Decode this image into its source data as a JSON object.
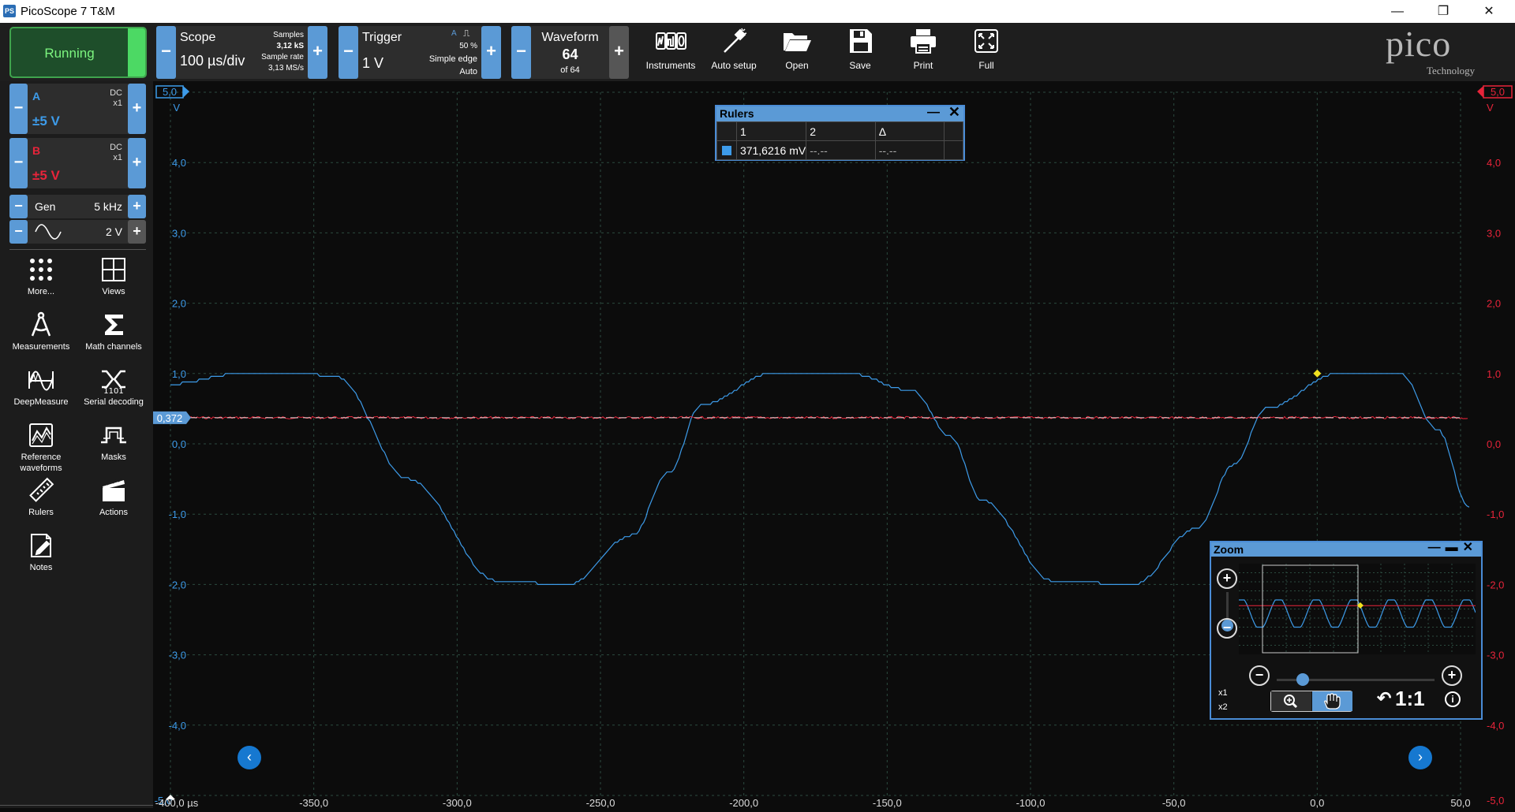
{
  "window": {
    "title": "PicoScope 7 T&M",
    "icon_text": "PS",
    "controls": [
      "minimize-icon",
      "restore-icon",
      "close-icon"
    ]
  },
  "toolbar": {
    "run_label": "Running",
    "scope": {
      "title": "Scope",
      "value": "100 µs/div",
      "samples_label": "Samples",
      "samples_value": "3,12 kS",
      "rate_label": "Sample rate",
      "rate_value": "3,13 MS/s"
    },
    "trigger": {
      "title": "Trigger",
      "value": "1 V",
      "channel": "A",
      "percent": "50 %",
      "mode": "Simple edge",
      "auto": "Auto"
    },
    "waveform": {
      "title": "Waveform",
      "value": "64",
      "of": "of 64"
    },
    "tools": [
      {
        "label": "Instruments",
        "icon": "instruments-icon"
      },
      {
        "label": "Auto setup",
        "icon": "auto-setup-icon"
      },
      {
        "label": "Open",
        "icon": "folder-open-icon"
      },
      {
        "label": "Save",
        "icon": "save-icon"
      },
      {
        "label": "Print",
        "icon": "print-icon"
      },
      {
        "label": "Full",
        "icon": "fullscreen-icon"
      }
    ],
    "logo_top": "pico",
    "logo_bottom": "Technology"
  },
  "sidebar": {
    "channel_a": {
      "name": "A",
      "coupling": "DC",
      "probe": "x1",
      "range": "±5 V",
      "color": "#3d9be9"
    },
    "channel_b": {
      "name": "B",
      "coupling": "DC",
      "probe": "x1",
      "range": "±5 V",
      "color": "#e8243a"
    },
    "gen": {
      "label": "Gen",
      "freq": "5 kHz",
      "ampl": "2 V",
      "wave_icon": "sine-wave-icon"
    },
    "tools": [
      {
        "label": "More...",
        "icon": "more-dots-icon"
      },
      {
        "label": "Views",
        "icon": "views-grid-icon"
      },
      {
        "label": "Measurements",
        "icon": "measurements-icon"
      },
      {
        "label": "Math channels",
        "icon": "sigma-icon"
      },
      {
        "label": "DeepMeasure",
        "icon": "deepmeasure-icon"
      },
      {
        "label": "Serial decoding",
        "icon": "serial-decoding-icon"
      },
      {
        "label": "Reference waveforms",
        "icon": "reference-waveforms-icon"
      },
      {
        "label": "Masks",
        "icon": "masks-icon"
      },
      {
        "label": "Rulers",
        "icon": "ruler-icon"
      },
      {
        "label": "Actions",
        "icon": "clapperboard-icon"
      },
      {
        "label": "Notes",
        "icon": "notes-icon"
      }
    ]
  },
  "plot": {
    "y_top_label_left": "5,0",
    "y_top_label_right": "5,0",
    "y_unit_left": "V",
    "y_unit_right": "V",
    "y_ticks": [
      "4,0",
      "3,0",
      "2,0",
      "1,0",
      "0,0",
      "-1,0",
      "-2,0",
      "-3,0",
      "-4,0"
    ],
    "y_bottom_label": "-5,0",
    "x_ticks": [
      "-400,0 µs",
      "-350,0",
      "-300,0",
      "-250,0",
      "-200,0",
      "-150,0",
      "-100,0",
      "-50,0",
      "0,0",
      "50,0"
    ],
    "ruler_value": "0,372",
    "colors": {
      "grid": "#2b4a3f",
      "channel_a": "#3d9be9",
      "channel_b": "#e8243a",
      "trigger_marker": "#f0e020",
      "axis_right": "#e8243a"
    }
  },
  "chart_data": {
    "type": "line",
    "title": "",
    "xlabel": "",
    "ylabel": "V",
    "xlim": [
      -400,
      50
    ],
    "ylim": [
      -5,
      5
    ],
    "grid": true,
    "series": [
      {
        "name": "A",
        "x": [
          -400,
          -375,
          -353,
          -342,
          -317,
          -286,
          -261,
          -239,
          -226,
          -215,
          -190,
          -163,
          -141,
          -128,
          -117,
          -92,
          -64,
          -42,
          -29,
          -18,
          7,
          29,
          42,
          53
        ],
        "values": [
          0.85,
          1.0,
          1.0,
          0.95,
          -0.5,
          -1.95,
          -2.0,
          -1.3,
          -0.4,
          0.55,
          1.0,
          1.0,
          0.75,
          0.1,
          -0.8,
          -1.95,
          -2.0,
          -1.2,
          -0.3,
          0.5,
          1.0,
          1.0,
          0.2,
          -0.9
        ]
      },
      {
        "name": "B",
        "x": [
          -400,
          53
        ],
        "values": [
          0.372,
          0.372
        ]
      }
    ],
    "trigger": {
      "x": 0,
      "y": 1.0
    }
  },
  "rulers_panel": {
    "title": "Rulers",
    "headers": [
      "1",
      "2",
      "Δ"
    ],
    "row": [
      "371,6216 mV",
      "--.--",
      "--.--"
    ]
  },
  "zoom_panel": {
    "title": "Zoom",
    "labels": [
      "x1",
      "x2"
    ],
    "ratio": "1:1"
  }
}
